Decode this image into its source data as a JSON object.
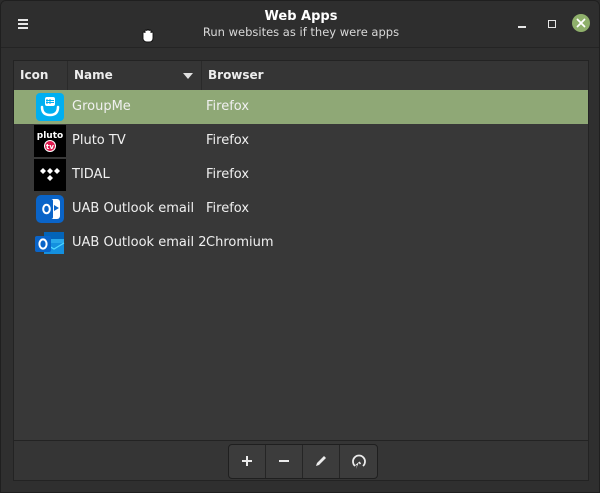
{
  "window": {
    "title": "Web Apps",
    "subtitle": "Run websites as if they were apps",
    "close_color": "#8fb06b"
  },
  "table": {
    "headers": {
      "icon": "Icon",
      "name": "Name",
      "browser": "Browser"
    },
    "sort_column": "Name",
    "selected_color": "#8fa876",
    "rows": [
      {
        "name": "GroupMe",
        "browser": "Firefox",
        "icon": "groupme-icon",
        "selected": true
      },
      {
        "name": "Pluto TV",
        "browser": "Firefox",
        "icon": "pluto-tv-icon",
        "icon_text": [
          "pluto",
          "tv"
        ]
      },
      {
        "name": "TIDAL",
        "browser": "Firefox",
        "icon": "tidal-icon"
      },
      {
        "name": "UAB Outlook email",
        "browser": "Firefox",
        "icon": "outlook-icon"
      },
      {
        "name": "UAB Outlook email 2",
        "browser": "Chromium",
        "icon": "outlook-icon"
      }
    ]
  },
  "toolbar": {
    "buttons": [
      "add-icon",
      "remove-icon",
      "edit-icon",
      "launch-icon"
    ]
  }
}
